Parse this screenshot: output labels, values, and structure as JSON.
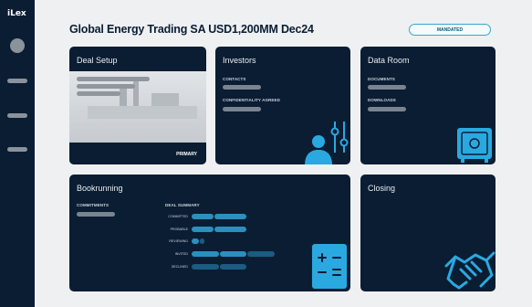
{
  "app": {
    "logo": "iLex"
  },
  "header": {
    "title": "Global Energy Trading SA USD1,200MM Dec24",
    "status_badge": "MANDATED"
  },
  "cards": {
    "deal_setup": {
      "title": "Deal Setup",
      "footer_label": "PRIMARY"
    },
    "investors": {
      "title": "Investors",
      "label_1": "CONTACTS",
      "label_2": "CONFIDENTIALITY AGREED"
    },
    "data_room": {
      "title": "Data Room",
      "label_1": "DOCUMENTS",
      "label_2": "DOWNLOADS"
    },
    "bookrunning": {
      "title": "Bookrunning",
      "commitments_label": "COMMITMENTS",
      "summary_label": "DEAL SUMMARY",
      "rows": [
        "COMMITTED",
        "PROBABLE",
        "REVIEWING",
        "INVITED",
        "DECLINED"
      ]
    },
    "closing": {
      "title": "Closing"
    }
  },
  "colors": {
    "navy": "#0b1d33",
    "accent": "#2aa9e0",
    "placeholder": "#7a8490"
  },
  "icons": {
    "investors": "users-settings-icon",
    "data_room": "safe-icon",
    "bookrunning": "calculator-icon",
    "closing": "handshake-icon"
  }
}
